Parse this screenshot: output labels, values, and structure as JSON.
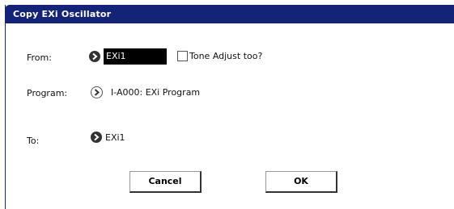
{
  "dialog": {
    "title": "Copy EXi Oscillator"
  },
  "from": {
    "label": "From:",
    "value": "EXi1",
    "tone_adjust_label": "Tone Adjust too?",
    "tone_adjust_checked": false
  },
  "program": {
    "label": "Program:",
    "value": "I-A000: EXi Program"
  },
  "to": {
    "label": "To:",
    "value": "EXi1"
  },
  "buttons": {
    "cancel": "Cancel",
    "ok": "OK"
  },
  "icons": {
    "selector_arrow": "chevron-right-icon"
  },
  "colors": {
    "title_bar": "#132378",
    "selected_field": "#000000"
  }
}
